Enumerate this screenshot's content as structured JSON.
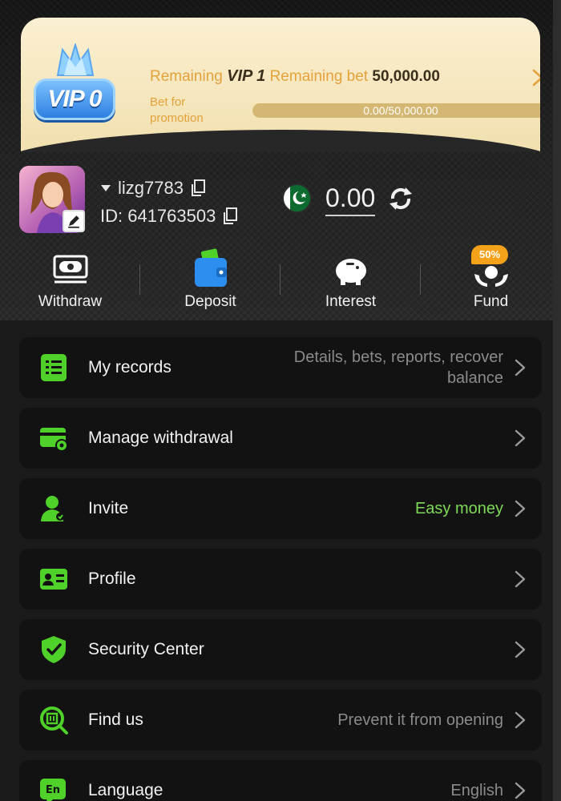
{
  "vip": {
    "badge_label": "VIP 0",
    "remaining_prefix": "Remaining",
    "next_level": "VIP 1",
    "remaining_bet_label": "Remaining bet",
    "remaining_bet_value": "50,000.00",
    "sub_label_line1": "Bet for",
    "sub_label_line2": "promotion",
    "progress_text": "0.00/50,000.00",
    "progress_fraction": 0
  },
  "user": {
    "username": "lizg7783",
    "id_text": "ID: 641763503",
    "balance": "0.00"
  },
  "actions": [
    {
      "label": "Withdraw",
      "icon": "withdraw-icon"
    },
    {
      "label": "Deposit",
      "icon": "wallet-icon"
    },
    {
      "label": "Interest",
      "icon": "piggy-bank-icon"
    },
    {
      "label": "Fund",
      "icon": "fund-hands-icon",
      "badge": "50%"
    }
  ],
  "menu": [
    {
      "title": "My records",
      "hint": "Details, bets, reports, recover balance",
      "icon": "records-icon"
    },
    {
      "title": "Manage withdrawal",
      "hint": "",
      "icon": "card-gear-icon"
    },
    {
      "title": "Invite",
      "hint": "Easy money",
      "icon": "invite-user-icon",
      "hint_color": "#7ed957"
    },
    {
      "title": "Profile",
      "hint": "",
      "icon": "id-card-icon"
    },
    {
      "title": "Security Center",
      "hint": "",
      "icon": "shield-check-icon"
    },
    {
      "title": "Find us",
      "hint": "Prevent it from opening",
      "icon": "find-us-icon"
    },
    {
      "title": "Language",
      "hint": "English",
      "icon": "language-icon"
    }
  ],
  "colors": {
    "accent_green": "#4fd12a",
    "gold": "#e3a23a",
    "background": "#1b1b1b",
    "card": "#121212"
  }
}
